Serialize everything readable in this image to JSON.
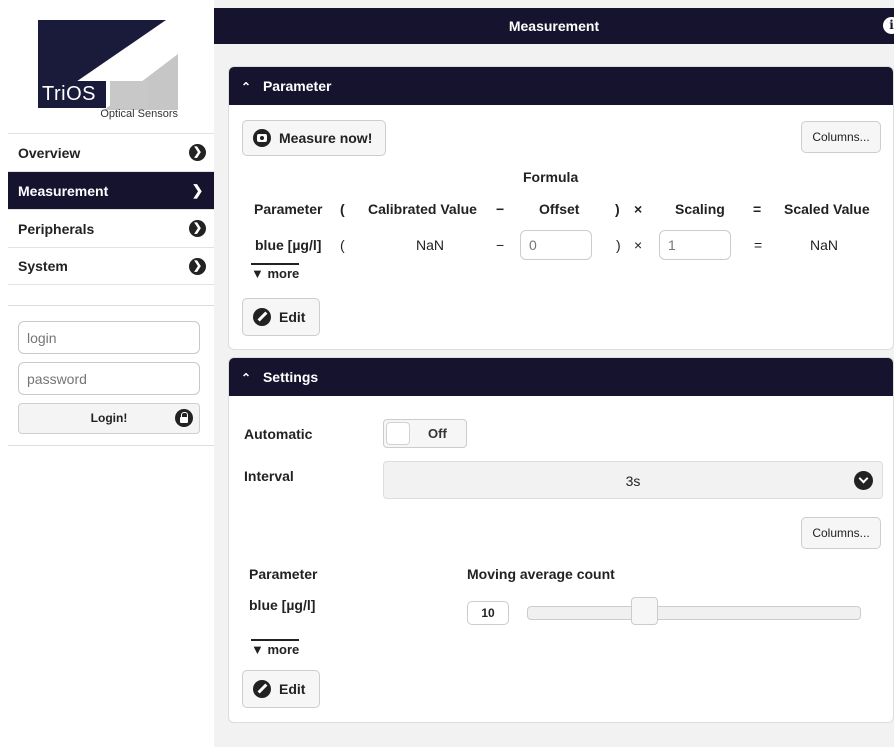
{
  "brand": {
    "logo_text": "TriOS",
    "logo_subtitle": "Optical Sensors"
  },
  "nav": {
    "items": [
      {
        "label": "Overview",
        "active": false
      },
      {
        "label": "Measurement",
        "active": true
      },
      {
        "label": "Peripherals",
        "active": false
      },
      {
        "label": "System",
        "active": false
      }
    ]
  },
  "login": {
    "login_placeholder": "login",
    "password_placeholder": "password",
    "button_label": "Login!"
  },
  "topbar": {
    "title": "Measurement",
    "info_icon": "info-icon"
  },
  "parameter_panel": {
    "title": "Parameter",
    "measure_button": "Measure now!",
    "columns_button": "Columns...",
    "formula_label": "Formula",
    "headers": [
      "Parameter",
      "(",
      "Calibrated Value",
      "−",
      "Offset",
      ")",
      "×",
      "Scaling",
      "=",
      "Scaled Value"
    ],
    "row": {
      "parameter": "blue [µg/l]",
      "open_paren": "(",
      "calibrated_value": "NaN",
      "minus": "−",
      "offset_placeholder": "0",
      "close_paren": ")",
      "times": "×",
      "scaling_placeholder": "1",
      "equals": "=",
      "scaled_value": "NaN"
    },
    "more_link": "▼ more",
    "edit_button": "Edit"
  },
  "settings_panel": {
    "title": "Settings",
    "automatic_label": "Automatic",
    "automatic_state": "Off",
    "interval_label": "Interval",
    "interval_value": "3s",
    "columns_button": "Columns...",
    "parameter_header": "Parameter",
    "moving_average_header": "Moving average count",
    "parameter_value": "blue [µg/l]",
    "moving_average_value": "10",
    "slider_fraction": 0.34,
    "more_link": "▼ more",
    "edit_button": "Edit"
  },
  "colors": {
    "header_bg": "#16132e",
    "panel_border": "#dddddd",
    "button_bg": "#f6f6f6"
  }
}
